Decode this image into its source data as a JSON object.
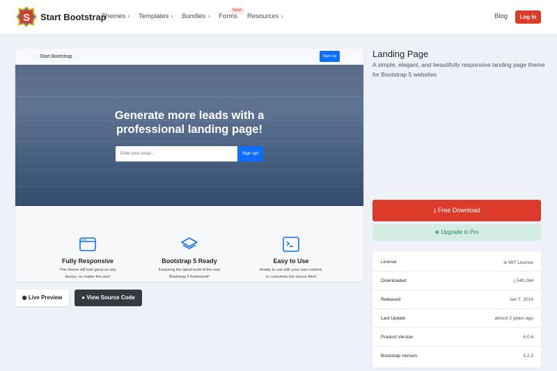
{
  "nav": {
    "brand": "Start Bootstrap",
    "items": [
      {
        "label": "Themes"
      },
      {
        "label": "Templates"
      },
      {
        "label": "Bundles"
      },
      {
        "label": "Forms",
        "badge": "New!"
      },
      {
        "label": "Resources"
      }
    ],
    "blog": "Blog",
    "login": "Log In"
  },
  "preview": {
    "brand": "Start Bootstrap",
    "signup": "Sign Up",
    "hero_title_line1": "Generate more leads with a",
    "hero_title_line2": "professional landing page!",
    "email_placeholder": "Enter your email...",
    "submit": "Sign up!",
    "features": [
      {
        "icon": "window-icon",
        "title": "Fully Responsive",
        "line1": "This theme will look great on any",
        "line2": "device, no matter the size!"
      },
      {
        "icon": "layers-icon",
        "title": "Bootstrap 5 Ready",
        "line1": "Featuring the latest build of the new",
        "line2": "Bootstrap 5 framework!"
      },
      {
        "icon": "terminal-icon",
        "title": "Easy to Use",
        "line1": "Ready to use with your own content,",
        "line2": "or customize the source files!"
      }
    ]
  },
  "actions": {
    "live_preview": "Live Preview",
    "view_source": "View Source Code"
  },
  "product": {
    "title": "Landing Page",
    "description": "A simple, elegant, and beautifully responsive landing page theme for Bootstrap 5 websites",
    "free_download": "Free Download",
    "upgrade": "Upgrade to Pro"
  },
  "info": [
    {
      "key": "License",
      "value": "MIT License"
    },
    {
      "key": "Downloaded",
      "value": "540,264"
    },
    {
      "key": "Released",
      "value": "Jan 7, 2014"
    },
    {
      "key": "Last Update",
      "value": "almost 2 years ago"
    },
    {
      "key": "Product Version",
      "value": "6.0.6"
    },
    {
      "key": "Bootstrap Version",
      "value": "5.2.3"
    }
  ],
  "colors": {
    "accent_red": "#dc3b2c",
    "primary_blue": "#0d6efd",
    "success_green": "#198754"
  }
}
